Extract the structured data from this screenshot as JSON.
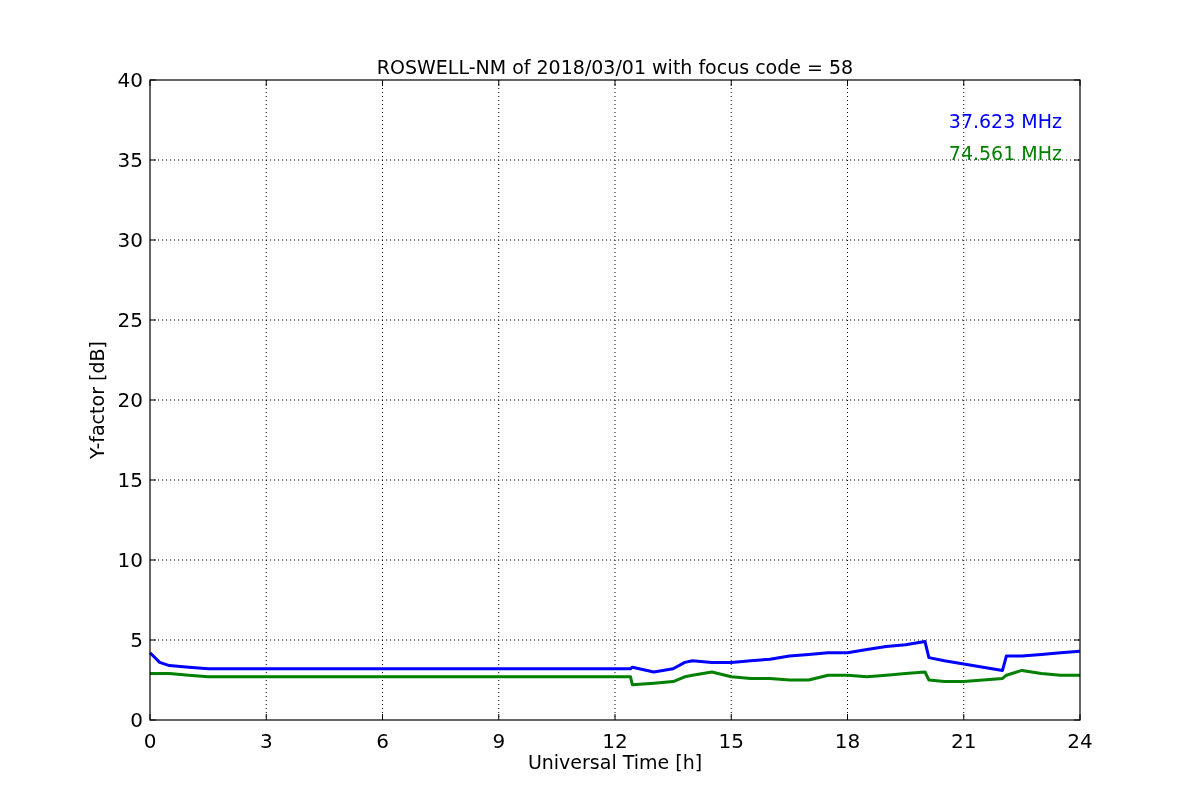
{
  "figure": {
    "chart_data": {
      "type": "line",
      "title": "ROSWELL-NM of 2018/03/01 with focus code = 58",
      "xlabel": "Universal Time [h]",
      "ylabel": "Y-factor [dB]",
      "x": [
        0,
        0.25,
        0.5,
        1,
        1.5,
        12.4,
        12.45,
        13,
        13.5,
        13.8,
        14,
        14.5,
        15,
        15.5,
        16,
        16.5,
        17,
        17.5,
        18,
        18.5,
        19,
        19.5,
        20,
        20.1,
        20.5,
        21,
        21.5,
        22,
        22.1,
        22.5,
        23,
        23.5,
        24
      ],
      "series": [
        {
          "name": "37.623 MHz",
          "color": "#0000ff",
          "values": [
            4.2,
            3.6,
            3.4,
            3.3,
            3.2,
            3.2,
            3.3,
            3.0,
            3.2,
            3.6,
            3.7,
            3.6,
            3.6,
            3.7,
            3.8,
            4.0,
            4.1,
            4.2,
            4.2,
            4.4,
            4.6,
            4.7,
            4.9,
            3.9,
            3.7,
            3.5,
            3.3,
            3.1,
            4.0,
            4.0,
            4.1,
            4.2,
            4.3
          ]
        },
        {
          "name": "74.561 MHz",
          "color": "#008000",
          "values": [
            2.9,
            2.9,
            2.9,
            2.8,
            2.7,
            2.7,
            2.2,
            2.3,
            2.4,
            2.7,
            2.8,
            3.0,
            2.7,
            2.6,
            2.6,
            2.5,
            2.5,
            2.8,
            2.8,
            2.7,
            2.8,
            2.9,
            3.0,
            2.5,
            2.4,
            2.4,
            2.5,
            2.6,
            2.8,
            3.1,
            2.9,
            2.8,
            2.8
          ]
        }
      ],
      "xlim": [
        0,
        24
      ],
      "ylim": [
        0,
        40
      ],
      "xticks": [
        0,
        3,
        6,
        9,
        12,
        15,
        18,
        21,
        24
      ],
      "yticks": [
        0,
        5,
        10,
        15,
        20,
        25,
        30,
        35,
        40
      ],
      "grid": true
    }
  }
}
